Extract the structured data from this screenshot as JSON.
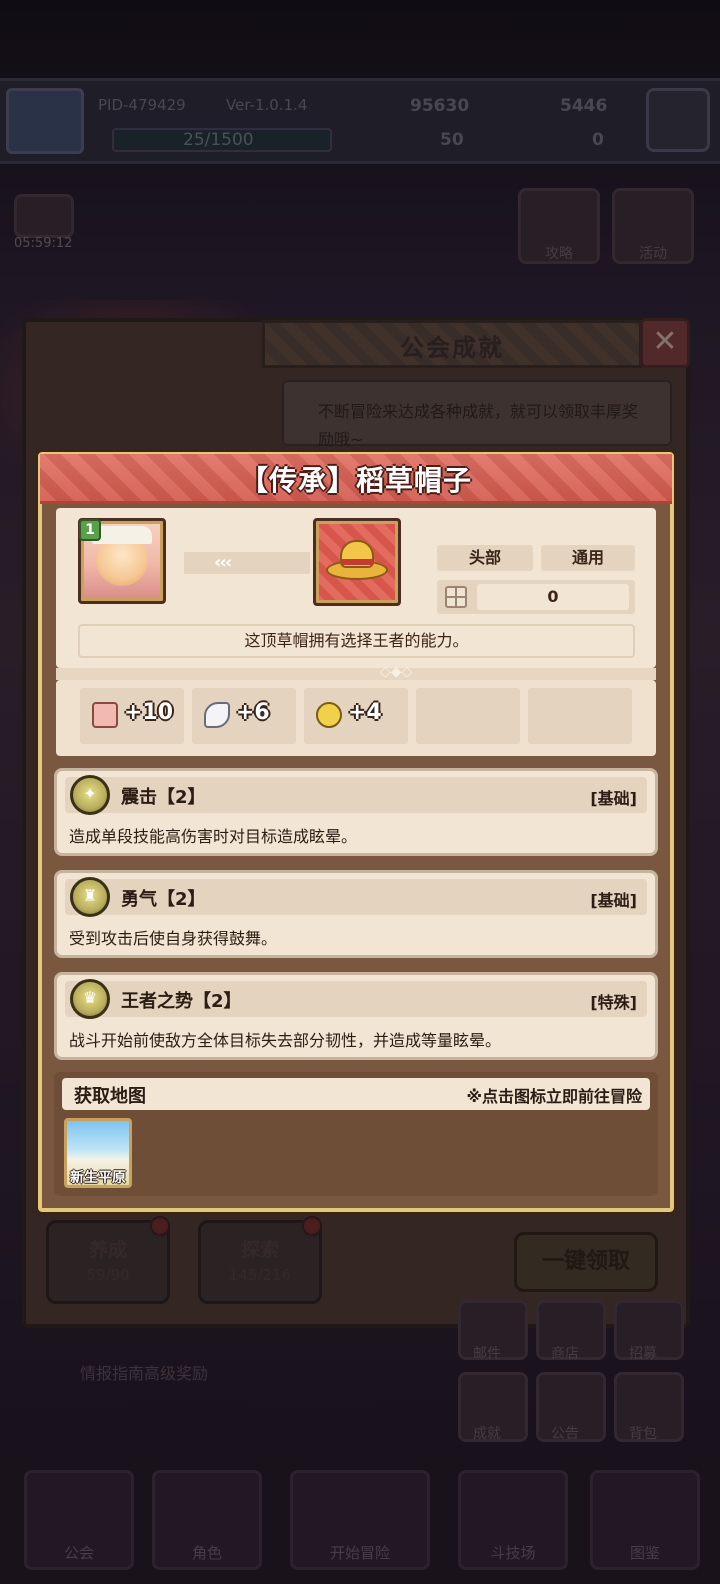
{
  "top_bar": {
    "pid": "PID-479429",
    "version": "Ver-1.0.1.4",
    "currency_gold": "95630",
    "currency_gem": "5446",
    "exp_progress": "25/1500",
    "currency_clover": "50",
    "currency_key": "0"
  },
  "event_timer": "05:59:12",
  "side_buttons": {
    "guide": "攻略",
    "activity": "活动"
  },
  "guild_panel": {
    "title": "公会成就",
    "description": "不断冒险来达成各种成就，就可以领取丰厚奖励哦~",
    "tabs": [
      {
        "label": "养成",
        "progress": "59/90"
      },
      {
        "label": "探索",
        "progress": "145/216"
      }
    ],
    "claim_all": "一键领取"
  },
  "background_hint": "情报指南高级奖励",
  "right_menu": [
    "邮件",
    "商店",
    "招募",
    "成就",
    "公告",
    "背包"
  ],
  "bottom_nav": [
    "公会",
    "角色",
    "开始冒险",
    "斗技场",
    "图鉴"
  ],
  "item_popup": {
    "title": "【传承】稻草帽子",
    "hero_level": "1",
    "arrows": "‹‹‹",
    "slot_tag": "头部",
    "class_tag": "通用",
    "price_value": "0",
    "description": "这顶草帽拥有选择王者的能力。",
    "stats": [
      {
        "icon": "fist-icon",
        "value": "+10"
      },
      {
        "icon": "wing-icon",
        "value": "+6"
      },
      {
        "icon": "stopwatch-icon",
        "value": "+4"
      }
    ],
    "skills": [
      {
        "icon": "shock-skill-icon",
        "name": "震击【2】",
        "type": "[基础]",
        "desc": "造成单段技能高伤害时对目标造成眩晕。"
      },
      {
        "icon": "courage-skill-icon",
        "name": "勇气【2】",
        "type": "[基础]",
        "desc": "受到攻击后使自身获得鼓舞。"
      },
      {
        "icon": "king-skill-icon",
        "name": "王者之势【2】",
        "type": "[特殊]",
        "desc": "战斗开始前使敌方全体目标失去部分韧性，并造成等量眩晕。"
      }
    ],
    "map_section": {
      "title": "获取地图",
      "hint": "※点击图标立即前往冒险",
      "maps": [
        {
          "label": "新生平原"
        }
      ]
    }
  },
  "colors": {
    "popup_frame": "#e4c879",
    "header_red": "#d35a4e",
    "card_bg": "#f3e5d3",
    "text_dark": "#2b1c14"
  }
}
